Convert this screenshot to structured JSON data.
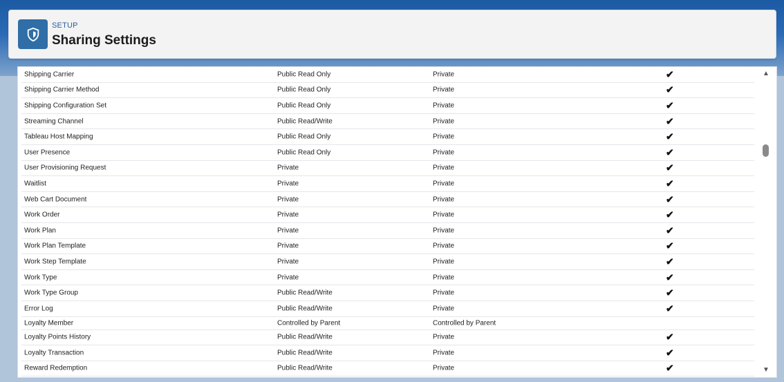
{
  "header": {
    "eyebrow": "SETUP",
    "title": "Sharing Settings",
    "icon": "shield-icon"
  },
  "table": {
    "rows": [
      {
        "name": "Shipping Carrier",
        "default_access": "Public Read Only",
        "external_access": "Private",
        "checked": true
      },
      {
        "name": "Shipping Carrier Method",
        "default_access": "Public Read Only",
        "external_access": "Private",
        "checked": true
      },
      {
        "name": "Shipping Configuration Set",
        "default_access": "Public Read Only",
        "external_access": "Private",
        "checked": true
      },
      {
        "name": "Streaming Channel",
        "default_access": "Public Read/Write",
        "external_access": "Private",
        "checked": true
      },
      {
        "name": "Tableau Host Mapping",
        "default_access": "Public Read Only",
        "external_access": "Private",
        "checked": true
      },
      {
        "name": "User Presence",
        "default_access": "Public Read Only",
        "external_access": "Private",
        "checked": true
      },
      {
        "name": "User Provisioning Request",
        "default_access": "Private",
        "external_access": "Private",
        "checked": true
      },
      {
        "name": "Waitlist",
        "default_access": "Private",
        "external_access": "Private",
        "checked": true
      },
      {
        "name": "Web Cart Document",
        "default_access": "Private",
        "external_access": "Private",
        "checked": true
      },
      {
        "name": "Work Order",
        "default_access": "Private",
        "external_access": "Private",
        "checked": true
      },
      {
        "name": "Work Plan",
        "default_access": "Private",
        "external_access": "Private",
        "checked": true
      },
      {
        "name": "Work Plan Template",
        "default_access": "Private",
        "external_access": "Private",
        "checked": true
      },
      {
        "name": "Work Step Template",
        "default_access": "Private",
        "external_access": "Private",
        "checked": true
      },
      {
        "name": "Work Type",
        "default_access": "Private",
        "external_access": "Private",
        "checked": true
      },
      {
        "name": "Work Type Group",
        "default_access": "Public Read/Write",
        "external_access": "Private",
        "checked": true
      },
      {
        "name": "Error Log",
        "default_access": "Public Read/Write",
        "external_access": "Private",
        "checked": true
      },
      {
        "name": "Loyalty Member",
        "default_access": "Controlled by Parent",
        "external_access": "Controlled by Parent",
        "checked": false
      },
      {
        "name": "Loyalty Points History",
        "default_access": "Public Read/Write",
        "external_access": "Private",
        "checked": true
      },
      {
        "name": "Loyalty Transaction",
        "default_access": "Public Read/Write",
        "external_access": "Private",
        "checked": true
      },
      {
        "name": "Reward Redemption",
        "default_access": "Public Read/Write",
        "external_access": "Private",
        "checked": true
      }
    ],
    "check_glyph": "✔"
  },
  "scrollbar": {
    "up_icon": "▲",
    "down_icon": "▼"
  }
}
